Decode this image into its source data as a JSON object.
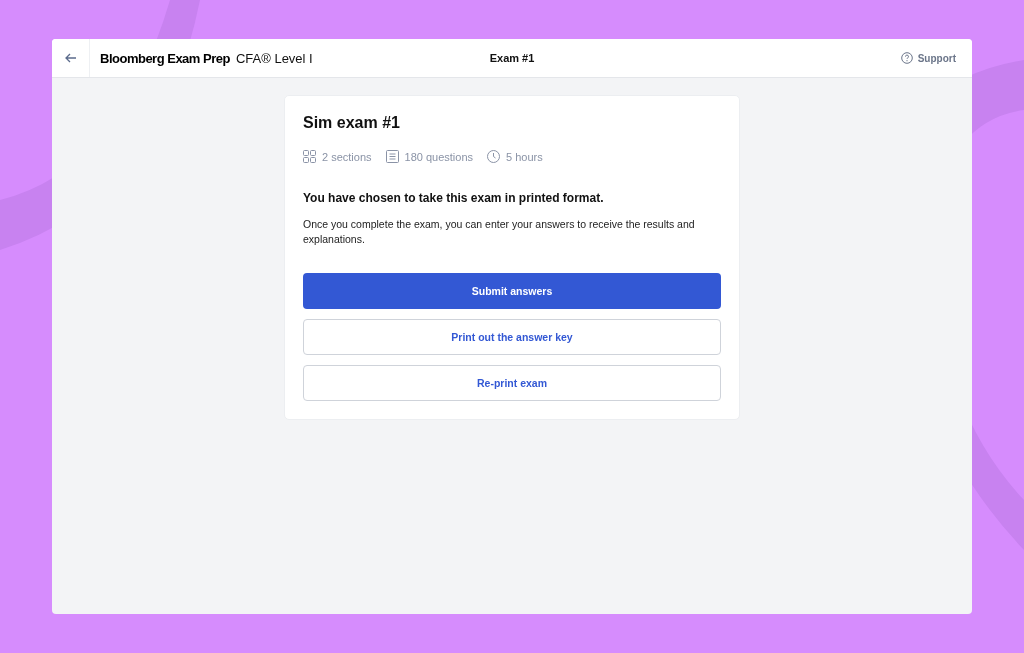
{
  "header": {
    "brand": "Bloomberg Exam Prep",
    "course": "CFA® Level I",
    "title": "Exam #1",
    "support": "Support"
  },
  "card": {
    "title": "Sim exam #1",
    "meta": [
      {
        "kind": "sections",
        "text": "2 sections"
      },
      {
        "kind": "questions",
        "text": "180 questions"
      },
      {
        "kind": "duration",
        "text": "5 hours"
      }
    ],
    "heading": "You have chosen to take this exam in printed format.",
    "body": "Once you complete the exam, you can enter your answers to receive the results and explanations.",
    "buttons": [
      {
        "kind": "primary",
        "label": "Submit answers"
      },
      {
        "kind": "secondary",
        "label": "Print out the answer key"
      },
      {
        "kind": "secondary",
        "label": "Re-print exam"
      }
    ]
  }
}
